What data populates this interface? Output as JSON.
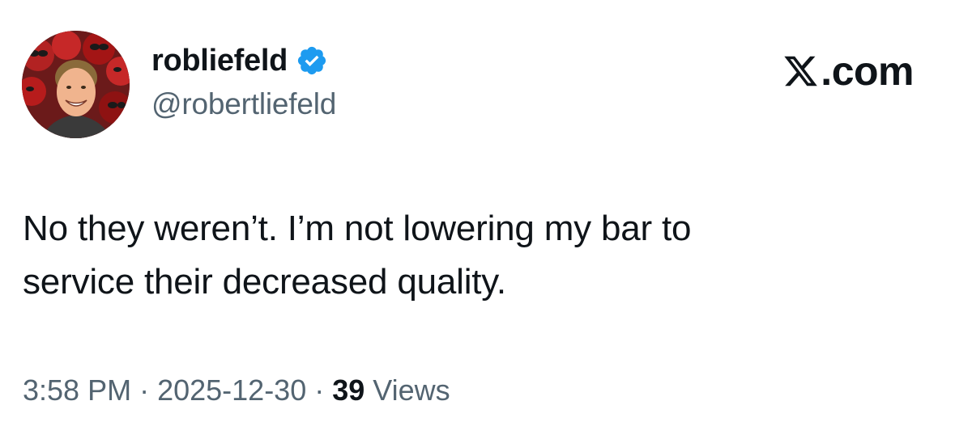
{
  "author": {
    "display_name": "robliefeld",
    "handle": "@robertliefeld",
    "verified": true,
    "verified_color": "#1d9bf0"
  },
  "brand": {
    "text": ".com",
    "icon": "x-logo-icon"
  },
  "tweet": {
    "text_line1": "No they weren’t. I’m not lowering my bar to",
    "text_line2": "service their decreased quality."
  },
  "meta": {
    "time": "3:58 PM",
    "separator": "·",
    "date": "2025-12-30",
    "views_count": "39",
    "views_label": "Views"
  },
  "colors": {
    "text_primary": "#0f1419",
    "text_secondary": "#536471",
    "background": "#ffffff"
  }
}
